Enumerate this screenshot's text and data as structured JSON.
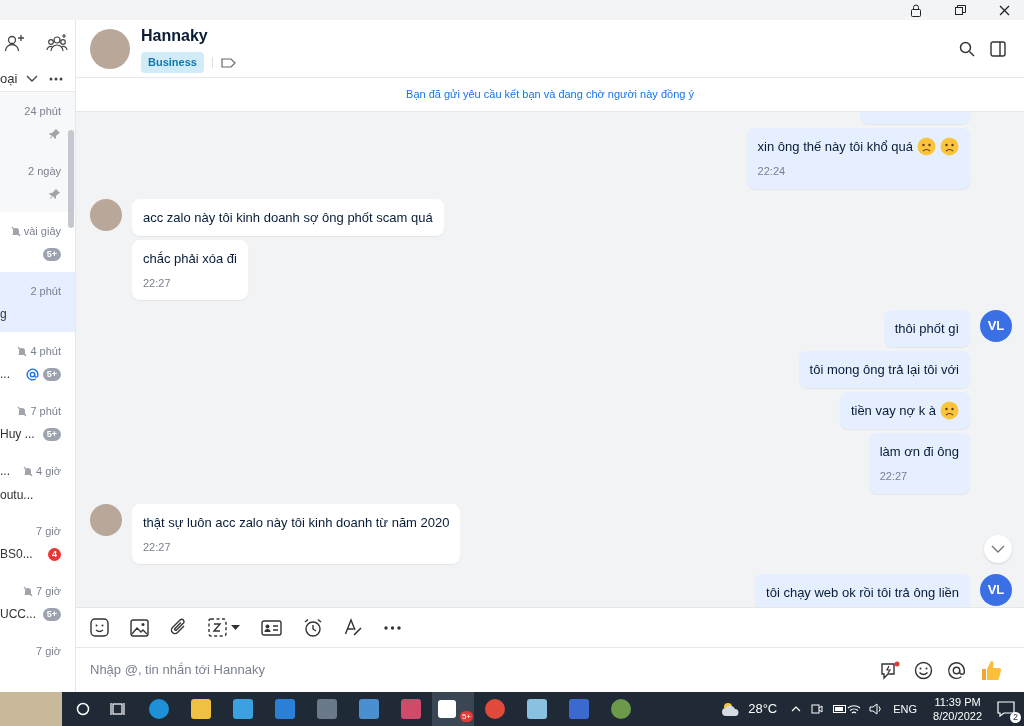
{
  "sidebar": {
    "filter_label": "oại",
    "conversations": [
      {
        "time": "24 phút",
        "pinned": true,
        "muted": false,
        "selected": false
      },
      {
        "time": "2 ngày",
        "pinned": true,
        "muted": false,
        "selected": false
      },
      {
        "time": "vài giây",
        "pinned": false,
        "muted": true,
        "selected": false,
        "badge": {
          "text": "5+",
          "color": "#9ca3af"
        }
      },
      {
        "time": "2 phút",
        "pinned": false,
        "muted": false,
        "selected": true,
        "preview": "g"
      },
      {
        "time": "4 phút",
        "pinned": false,
        "muted": true,
        "selected": false,
        "preview": "...",
        "mention": true,
        "badge": {
          "text": "5+",
          "color": "#9ca3af"
        }
      },
      {
        "time": "7 phút",
        "pinned": false,
        "muted": true,
        "selected": false,
        "preview": "Huy ...",
        "badge": {
          "text": "5+",
          "color": "#9ca3af"
        }
      },
      {
        "time": "4 giờ",
        "title": "...",
        "pinned": false,
        "muted": true,
        "selected": false,
        "preview": "outu..."
      },
      {
        "time": "7 giờ",
        "pinned": false,
        "muted": false,
        "selected": false,
        "preview": "BS0...",
        "badge": {
          "text": "4",
          "color": "#e53935"
        }
      },
      {
        "time": "7 giờ",
        "pinned": false,
        "muted": true,
        "selected": false,
        "preview": "UCC...",
        "badge": {
          "text": "5+",
          "color": "#9ca3af"
        }
      },
      {
        "time": "7 giờ",
        "pinned": false,
        "muted": false,
        "selected": false
      }
    ]
  },
  "chat": {
    "name": "Hannaky",
    "tag": "Business",
    "banner": "Bạn đã gửi yêu cầu kết bạn và đang chờ người này đồng ý",
    "groups": [
      {
        "kind": "outgoing",
        "messages": [
          {
            "partial": true
          },
          {
            "text": "xin ông thế này tôi khổ quá",
            "emojis": [
              {
                "kind": "frown"
              },
              {
                "kind": "frown"
              }
            ],
            "time": "22:24"
          }
        ]
      },
      {
        "kind": "incoming",
        "messages": [
          {
            "text": "acc zalo này tôi kinh doanh sợ ông phốt scam quá"
          },
          {
            "text": "chắc phải xóa đi",
            "time": "22:27"
          }
        ]
      },
      {
        "kind": "outgoing",
        "initials": "VL",
        "messages": [
          {
            "text": "thôi phốt gì"
          },
          {
            "text": "tôi mong ông trả lại tôi với"
          },
          {
            "text": "tiền vay nợ k à",
            "emojis": [
              {
                "kind": "frown"
              }
            ]
          },
          {
            "text": "làm ơn đi ông",
            "time": "22:27"
          }
        ]
      },
      {
        "kind": "incoming",
        "messages": [
          {
            "text": "thật sự luôn acc zalo này tôi kinh doanh từ năm 2020",
            "time": "22:27"
          }
        ]
      },
      {
        "kind": "outgoing",
        "initials": "VL",
        "messages": [
          {
            "text": "tôi chạy web ok rồi tôi trả ông liền"
          }
        ]
      }
    ],
    "input": {
      "placeholder": "Nhập @, tin nhắn tới Hannaky"
    }
  },
  "taskbar": {
    "zalo_badge": "5+",
    "temperature": "28°C",
    "language": "ENG",
    "time": "11:39 PM",
    "date": "8/20/2022",
    "notifications": "2"
  }
}
